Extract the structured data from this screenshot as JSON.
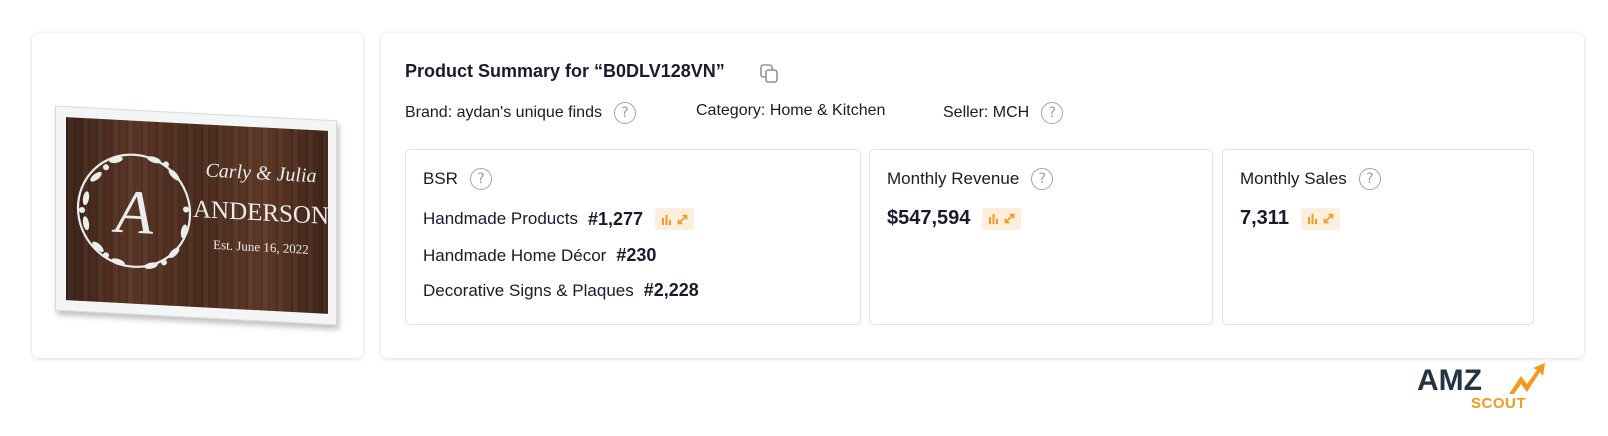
{
  "product_image": {
    "sign_name": "Carly & Julia",
    "sign_initial": "A",
    "sign_surname": "ANDERSON",
    "sign_date": "Est. June 16, 2022"
  },
  "summary": {
    "title": "Product Summary for “B0DLV128VN”",
    "brand": "Brand: aydan's unique finds",
    "category": "Category: Home & Kitchen",
    "seller": "Seller: MCH",
    "help_glyph": "?"
  },
  "bsr": {
    "label": "BSR",
    "items": [
      {
        "category": "Handmade Products",
        "rank": "#1,277"
      },
      {
        "category": "Handmade Home Décor",
        "rank": "#230"
      },
      {
        "category": "Decorative Signs & Plaques",
        "rank": "#2,228"
      }
    ]
  },
  "revenue": {
    "label": "Monthly Revenue",
    "value": "$547,594"
  },
  "sales": {
    "label": "Monthly Sales",
    "value": "7,311"
  },
  "logo": {
    "top": "AMZ",
    "bottom": "SCOUT"
  },
  "colors": {
    "accent_orange": "#f39a1e",
    "chart_button_bg": "#fdeedd",
    "text_dark": "#1a1a2e",
    "logo_dark": "#243444"
  },
  "icons": [
    "copy-icon",
    "help-icon",
    "bar-chart-icon",
    "expand-icon",
    "logo-arrow-icon"
  ]
}
